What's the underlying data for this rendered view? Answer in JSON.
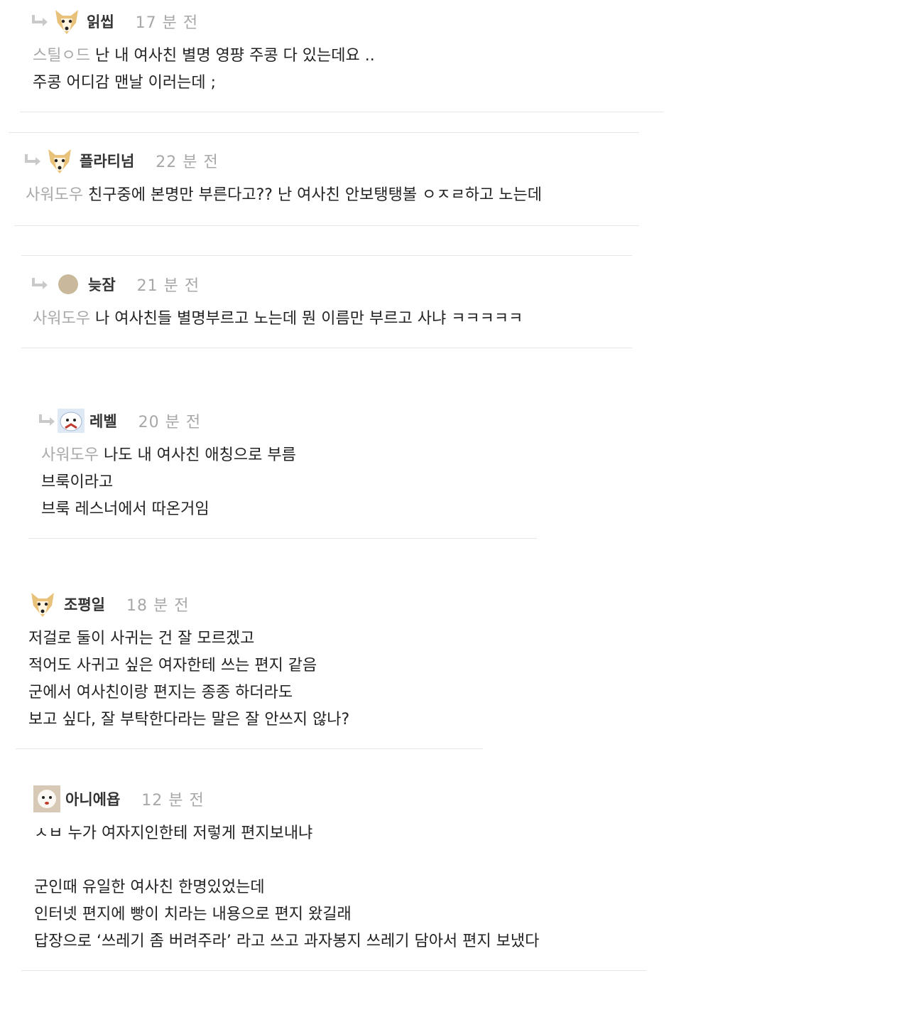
{
  "comments": [
    {
      "nick": "읽씹",
      "time": "17 분 전",
      "mention": "스틸ㅇ드",
      "lines": [
        "난 내 여사친 별명 영퍙 주콩 다 있는데요 ..",
        "주콩 어디감 맨날 이러는데 ;"
      ],
      "avatar": "dog-icon"
    },
    {
      "nick": "플라티넘",
      "time": "22 분 전",
      "mention": "사워도우",
      "lines": [
        "친구중에 본명만 부른다고?? 난 여사친 안보탱탱볼 ㅇㅈㄹ하고 노는데"
      ],
      "avatar": "dog-icon"
    },
    {
      "nick": "늦잠",
      "time": "21 분 전",
      "mention": "사워도우",
      "lines": [
        "나 여사친들 별명부르고 노는데 뭔 이름만 부르고 사냐 ㅋㅋㅋㅋㅋ"
      ],
      "avatar": "circle-avatar-icon"
    },
    {
      "nick": "레벨",
      "time": "20 분 전",
      "mention": "사워도우",
      "lines": [
        "나도 내 여사친 애칭으로 부름",
        "브룩이라고",
        "브룩 레스너에서 따온거임"
      ],
      "avatar": "polar-bear-icon"
    },
    {
      "nick": "조평일",
      "time": "18 분 전",
      "mention": "",
      "lines": [
        "저걸로 둘이 사귀는 건 잘 모르겠고",
        "적어도 사귀고 싶은 여자한테 쓰는 편지 같음",
        "군에서 여사친이랑 편지는 종종 하더라도",
        "보고 싶다, 잘 부탁한다라는 말은 잘 안쓰지 않나?"
      ],
      "avatar": "dog-icon"
    },
    {
      "nick": "아니에욥",
      "time": "12 분 전",
      "mention": "",
      "lines": [
        "ㅅㅂ 누가 여자지인한테 저렇게 편지보내냐",
        "",
        "군인때 유일한 여사친 한명있었는데",
        "인터넷 편지에 빵이 치라는 내용으로 편지 왔길래",
        "답장으로 ‘쓰레기 좀 버려주라’ 라고 쓰고 과자봉지 쓰레기 담아서 편지 보냈다"
      ],
      "avatar": "puppy-photo-icon"
    }
  ]
}
